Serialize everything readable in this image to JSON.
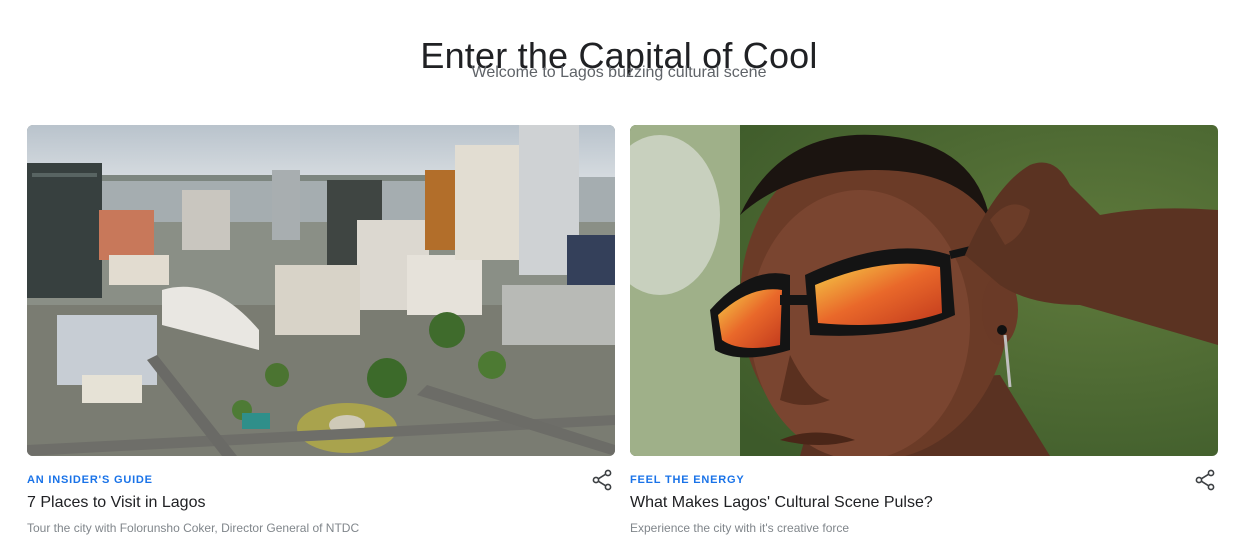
{
  "header": {
    "title": "Enter the Capital of Cool",
    "subtitle": "Welcome to Lagos buzzing cultural scene"
  },
  "cards": [
    {
      "eyebrow": "AN INSIDER'S GUIDE",
      "title": "7 Places to Visit in Lagos",
      "description": "Tour the city with Folorunsho Coker, Director General of NTDC",
      "share_icon": "share-icon"
    },
    {
      "eyebrow": "FEEL THE ENERGY",
      "title": "What Makes Lagos' Cultural Scene Pulse?",
      "description": "Experience the city with it's creative force",
      "share_icon": "share-icon"
    }
  ],
  "colors": {
    "accent": "#1a73e8",
    "title": "#202124",
    "muted": "#80868b"
  }
}
